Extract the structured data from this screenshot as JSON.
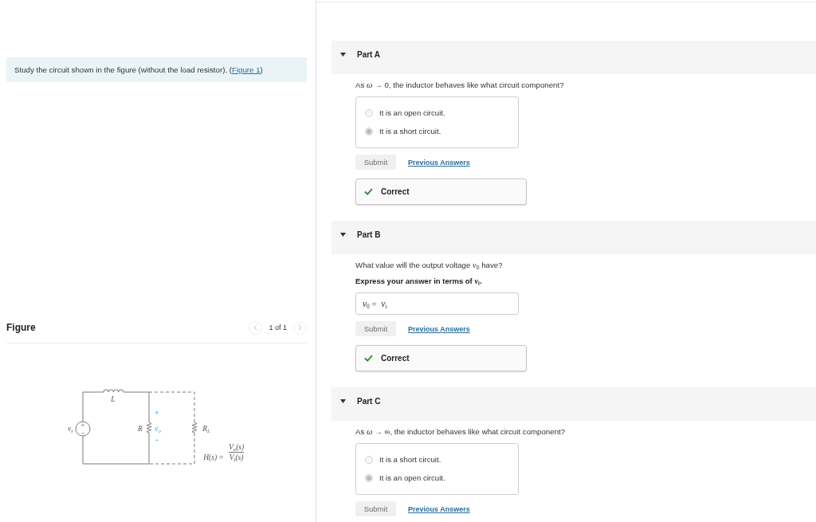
{
  "intro": {
    "before": "Study the circuit shown in the figure (without the load resistor). (",
    "link": "Figure 1",
    "after": ")"
  },
  "figure": {
    "title": "Figure",
    "pager": {
      "previous": {
        "disabled": true
      },
      "page": "1 of 1",
      "next": {
        "disabled": true
      }
    },
    "labels": {
      "inductor": "L",
      "source": "v$_{i}$",
      "source_plus": "+",
      "source_minus": "−",
      "resistor": "R",
      "output": "v$_{o}$",
      "output_plus": "+",
      "output_minus": "−",
      "load": "R$_{L}$",
      "transfer_lhs": "H(s) =",
      "transfer_numerator": "V$_{o}$(s)",
      "transfer_denominator": "V$_{i}$(s)"
    }
  },
  "parts": [
    {
      "title": "Part A",
      "expanded": true,
      "kind": "choice",
      "question": "As *ω* → 0, the inductor behaves like what circuit component?",
      "options": [
        {
          "label": "It is an open circuit.",
          "selected": false
        },
        {
          "label": "It is a short circuit.",
          "selected": true
        }
      ],
      "submit": {
        "label": "Submit",
        "disabled": true
      },
      "previous_answers": "Previous Answers",
      "feedback": {
        "correct": true,
        "text": "Correct"
      }
    },
    {
      "title": "Part B",
      "expanded": true,
      "kind": "expression",
      "question": "What value will the output voltage *v*$_{0}$ have?",
      "instruction": "Express your answer in terms of *v*$_{i}$.",
      "answer": {
        "label": "*v*$_{0}$ =",
        "value": "*v*$_{i}$"
      },
      "submit": {
        "label": "Submit",
        "disabled": true
      },
      "previous_answers": "Previous Answers",
      "feedback": {
        "correct": true,
        "text": "Correct"
      }
    },
    {
      "title": "Part C",
      "expanded": true,
      "kind": "choice",
      "question": "As *ω* → ∞, the inductor behaves like what circuit component?",
      "options": [
        {
          "label": "It is a short circuit.",
          "selected": false
        },
        {
          "label": "It is an open circuit.",
          "selected": true
        }
      ],
      "submit": {
        "label": "Submit",
        "disabled": true
      },
      "previous_answers": "Previous Answers"
    }
  ]
}
